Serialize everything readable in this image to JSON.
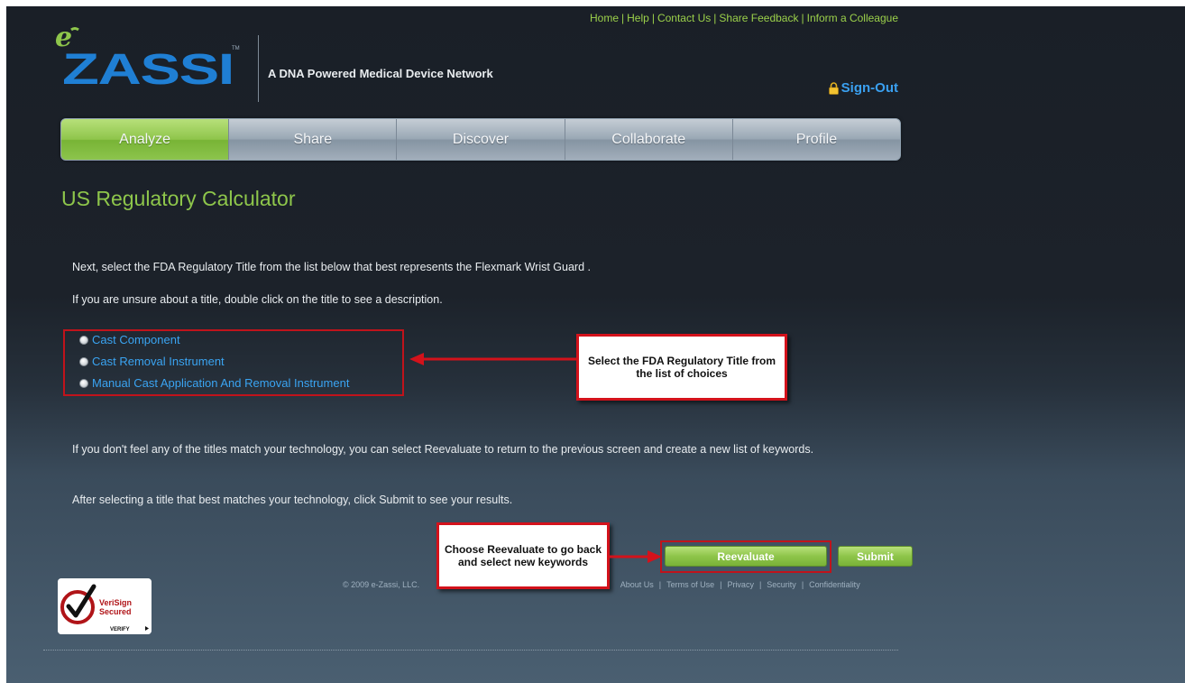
{
  "header": {
    "top_links": [
      "Home",
      "Help",
      "Contact Us",
      "Share Feedback",
      "Inform a Colleague"
    ],
    "logo_text": "ZASSI",
    "logo_prefix": "e",
    "tagline": "A DNA Powered Medical Device Network",
    "sign_out_label": "Sign-Out"
  },
  "nav": {
    "tabs": [
      {
        "label": "Analyze",
        "active": true
      },
      {
        "label": "Share",
        "active": false
      },
      {
        "label": "Discover",
        "active": false
      },
      {
        "label": "Collaborate",
        "active": false
      },
      {
        "label": "Profile",
        "active": false
      }
    ]
  },
  "main": {
    "title": "US Regulatory Calculator",
    "intro_1": "Next, select the FDA Regulatory Title from the list below that best represents the Flexmark Wrist Guard .",
    "intro_2": "If you are unsure about a title, double click on the title to see a description.",
    "options": [
      "Cast Component",
      "Cast Removal Instrument",
      "Manual Cast Application And Removal Instrument"
    ],
    "note_1": "If you don't feel any of the titles match your technology, you can select Reevaluate to return to the previous screen and create a new list of keywords.",
    "note_2": "After selecting a title that best matches your technology, click Submit to see your results.",
    "reevaluate_label": "Reevaluate",
    "submit_label": "Submit"
  },
  "callouts": {
    "select_title": "Select the FDA Regulatory Title from the list of choices",
    "reevaluate_hint": "Choose Reevaluate to go back and select new keywords"
  },
  "footer": {
    "copyright": "© 2009 e-Zassi, LLC.",
    "links": [
      "About Us",
      "Terms of Use",
      "Privacy",
      "Security",
      "Confidentiality"
    ],
    "badge_line_1": "VeriSign",
    "badge_line_2": "Secured",
    "badge_line_3": "VERIFY"
  },
  "colors": {
    "accent_green": "#8ec64b",
    "link_blue": "#3aa4f2",
    "callout_red": "#d3121b"
  }
}
